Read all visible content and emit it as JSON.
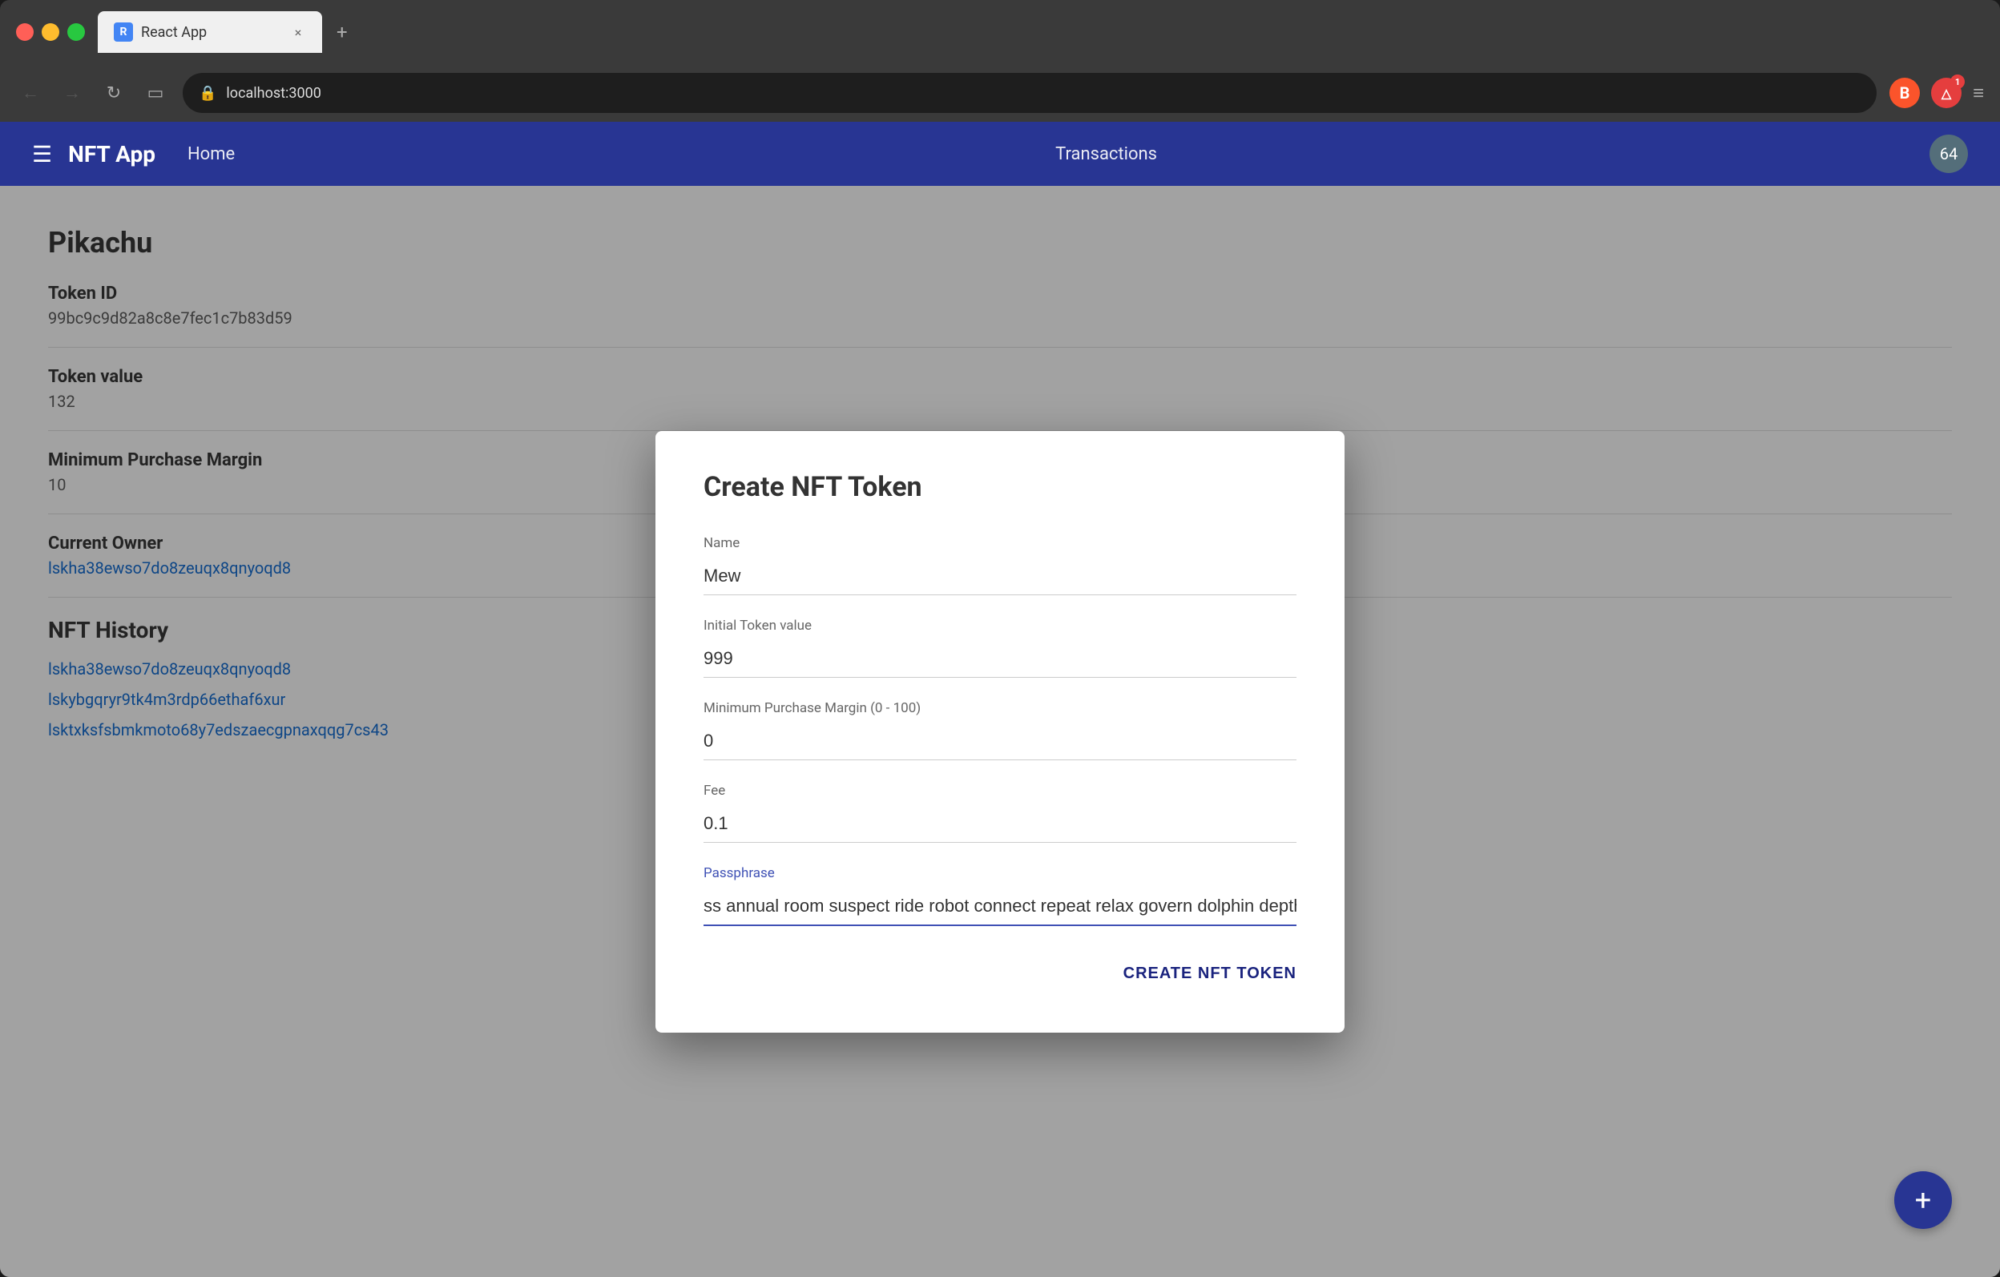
{
  "browser": {
    "tab_title": "React App",
    "tab_favicon_text": "R",
    "url": "localhost:3000",
    "close_label": "×",
    "new_tab_label": "+",
    "menu_label": "≡"
  },
  "nav": {
    "hamburger_label": "☰",
    "brand": "NFT App",
    "home_link": "Home",
    "transactions_link": "Transactions",
    "badge_count": "64"
  },
  "page": {
    "pokemon_name": "Pikachu",
    "token_id_label": "Token ID",
    "token_id_value": "99bc9c9d82a8c8e7fec1c7b83d59",
    "token_value_label": "Token value",
    "token_value": "132",
    "min_purchase_label": "Minimum Purchase Margin",
    "min_purchase_value": "10",
    "current_owner_label": "Current Owner",
    "current_owner_value": "lskha38ewso7do8zeuqx8qnyoqd8",
    "nft_history_title": "NFT History",
    "history_links": [
      "lskha38ewso7do8zeuqx8qnyoqd8",
      "lskybgqryr9tk4m3rdp66ethaf6xur",
      "lsktxksfsbmkmoto68y7edszaecgpnaxqqg7cs43"
    ]
  },
  "modal": {
    "title": "Create NFT Token",
    "name_label": "Name",
    "name_value": "Mew",
    "token_value_label": "Initial Token value",
    "token_value_value": "999",
    "min_margin_label": "Minimum Purchase Margin (0 - 100)",
    "min_margin_value": "0",
    "fee_label": "Fee",
    "fee_value": "0.1",
    "passphrase_label": "Passphrase",
    "passphrase_value": "ss annual room suspect ride robot connect repeat relax govern dolphin depth",
    "create_btn_label": "CREATE NFT TOKEN"
  },
  "fab_label": "+"
}
